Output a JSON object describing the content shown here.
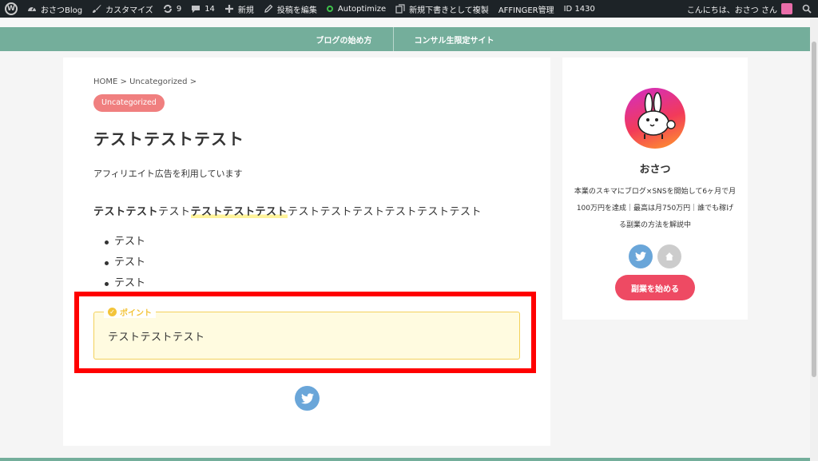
{
  "adminbar": {
    "site": "おさつBlog",
    "customize": "カスタマイズ",
    "updates_count": "9",
    "comments_count": "14",
    "new": "新規",
    "edit_post": "投稿を編集",
    "autoptimize": "Autoptimize",
    "duplicate": "新規下書きとして複製",
    "affinger": "AFFINGER管理",
    "post_id": "ID 1430",
    "greeting": "こんにちは、おさつ さん"
  },
  "nav": {
    "items": [
      "ブログの始め方",
      "コンサル生限定サイト"
    ]
  },
  "article": {
    "breadcrumb": "HOME > Uncategorized >",
    "category": "Uncategorized",
    "title": "テストテストテスト",
    "affiliate": "アフィリエイト広告を利用しています",
    "body_bold": "テストテスト",
    "body_plain1": "テスト",
    "body_marker": "テストテストテスト",
    "body_plain2": "テストテストテストテストテストテスト",
    "list": [
      "テスト",
      "テスト",
      "テスト"
    ],
    "point_label": "ポイント",
    "point_text": "テストテストテスト"
  },
  "sidebar": {
    "name": "おさつ",
    "desc": "本業のスキマにブログ×SNSを開始して6ヶ月で月100万円を達成｜最高は月750万円｜誰でも稼げる副業の方法を解説中",
    "cta": "副業を始める"
  },
  "colors": {
    "nav": "#74ae9b",
    "badge": "#f07f7f",
    "point_border": "#f3d15b",
    "point_bg": "#fffbe0",
    "cta": "#ee4a63",
    "twitter": "#6aa6d9",
    "highlight_frame": "#ff0000"
  }
}
